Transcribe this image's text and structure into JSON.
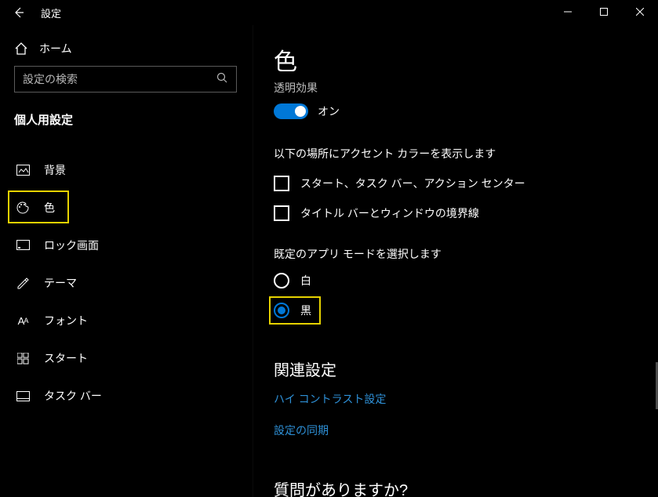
{
  "titlebar": {
    "title": "設定"
  },
  "sidebar": {
    "home": "ホーム",
    "search_placeholder": "設定の検索",
    "section": "個人用設定",
    "items": [
      {
        "label": "背景"
      },
      {
        "label": "色"
      },
      {
        "label": "ロック画面"
      },
      {
        "label": "テーマ"
      },
      {
        "label": "フォント"
      },
      {
        "label": "スタート"
      },
      {
        "label": "タスク バー"
      }
    ]
  },
  "content": {
    "page_title": "色",
    "transparency_label": "透明効果",
    "toggle_state": "オン",
    "accent_head": "以下の場所にアクセント カラーを表示します",
    "check1": "スタート、タスク バー、アクション センター",
    "check2": "タイトル バーとウィンドウの境界線",
    "mode_head": "既定のアプリ モードを選択します",
    "radio_light": "白",
    "radio_dark": "黒",
    "related_head": "関連設定",
    "link1": "ハイ コントラスト設定",
    "link2": "設定の同期",
    "question_head": "質問がありますか?"
  }
}
